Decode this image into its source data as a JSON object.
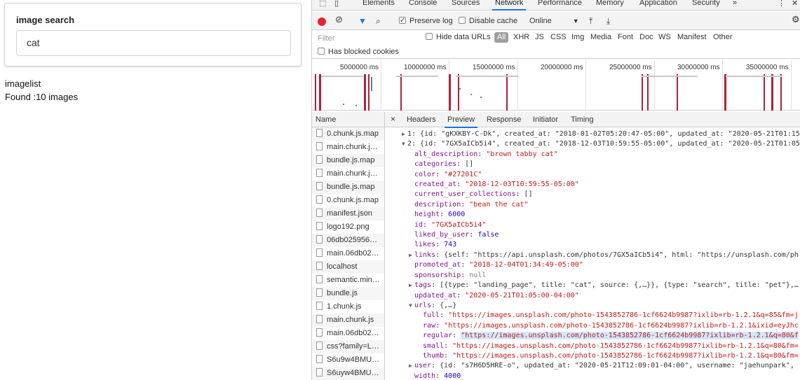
{
  "app": {
    "search_label": "image search",
    "search_value": "cat",
    "list_heading": "imagelist",
    "found_text": "Found :10 images"
  },
  "devtools": {
    "tabs": [
      "Elements",
      "Console",
      "Sources",
      "Network",
      "Performance",
      "Memory",
      "Application",
      "Security"
    ],
    "more_tabs": "»",
    "toolbar": {
      "preserve_log": "Preserve log",
      "disable_cache": "Disable cache",
      "throttle": "Online"
    },
    "filter": {
      "placeholder": "Filter",
      "hide_data_urls": "Hide data URLs",
      "all": "All",
      "types": [
        "XHR",
        "JS",
        "CSS",
        "Img",
        "Media",
        "Font",
        "Doc",
        "WS",
        "Manifest",
        "Other"
      ],
      "blocked": "Has blocked cookies"
    },
    "timeline_ticks": [
      "5000000 ms",
      "10000000 ms",
      "15000000 ms",
      "20000000 ms",
      "25000000 ms",
      "30000000 ms",
      "35000000 ms"
    ],
    "requests_header": "Name",
    "requests": [
      "0.chunk.js.map",
      "main.chunk.j…",
      "bundle.js.map",
      "main.chunk.j…",
      "bundle.js.map",
      "0.chunk.js.map",
      "manifest.json",
      "logo192.png",
      "06db025956…",
      "main.06db02…",
      "localhost",
      "semantic.min…",
      "bundle.js",
      "1.chunk.js",
      "main.chunk.js",
      "main.06db02…",
      "css?family=L…",
      "S6u9w4BMU…",
      "S6uyw4BMU…"
    ],
    "detail_tabs": [
      "Headers",
      "Preview",
      "Response",
      "Initiator",
      "Timing"
    ],
    "close_glyph": "×",
    "preview": {
      "l1": "1: {id: \"gKXKBY-C-Dk\", created_at: \"2018-01-02T05:20:47-05:00\", updated_at: \"2020-05-21T01:15",
      "l2": "2: {id: \"7GX5aICb5i4\", created_at: \"2018-12-03T10:59:55-05:00\", updated_at: \"2020-05-21T01:05",
      "alt_description": "\"brown tabby cat\"",
      "categories": "[]",
      "color": "\"#27201C\"",
      "created_at": "\"2018-12-03T10:59:55-05:00\"",
      "current_user_collections": "[]",
      "description": "\"bean the cat\"",
      "height": "6000",
      "id": "\"7GX5aICb5i4\"",
      "liked_by_user": "false",
      "likes": "743",
      "links": "{self: \"https://api.unsplash.com/photos/7GX5aICb5i4\", html: \"https://unsplash.com/ph",
      "promoted_at": "\"2018-12-04T01:34:49-05:00\"",
      "sponsorship": "null",
      "tags": "[{type: \"landing_page\", title: \"cat\", source: {,…}}, {type: \"search\", title: \"pet\"},…",
      "updated_at": "\"2020-05-21T01:05:00-04:00\"",
      "urls": "{,…}",
      "full": "\"https://images.unsplash.com/photo-1543852786-1cf6624b9987?ixlib=rb-1.2.1&q=85&fm=j",
      "raw": "\"https://images.unsplash.com/photo-1543852786-1cf6624b9987?ixlib=rb-1.2.1&ixid=eyJhc",
      "regular": "\"https://images.unsplash.com/photo-1543852786-1cf6624b9987?ixlib=rb-1.2.1&q=80&f",
      "small": "\"https://images.unsplash.com/photo-1543852786-1cf6624b9987?ixlib=rb-1.2.1&q=80&fm=",
      "thumb": "\"https://images.unsplash.com/photo-1543852786-1cf6624b9987?ixlib=rb-1.2.1&q=80&fm=",
      "user": "{id: \"s7H6D5HRE-o\", updated_at: \"2020-05-21T12:09:01-04:00\", username: \"jaehunpark\",",
      "width": "4000"
    }
  }
}
